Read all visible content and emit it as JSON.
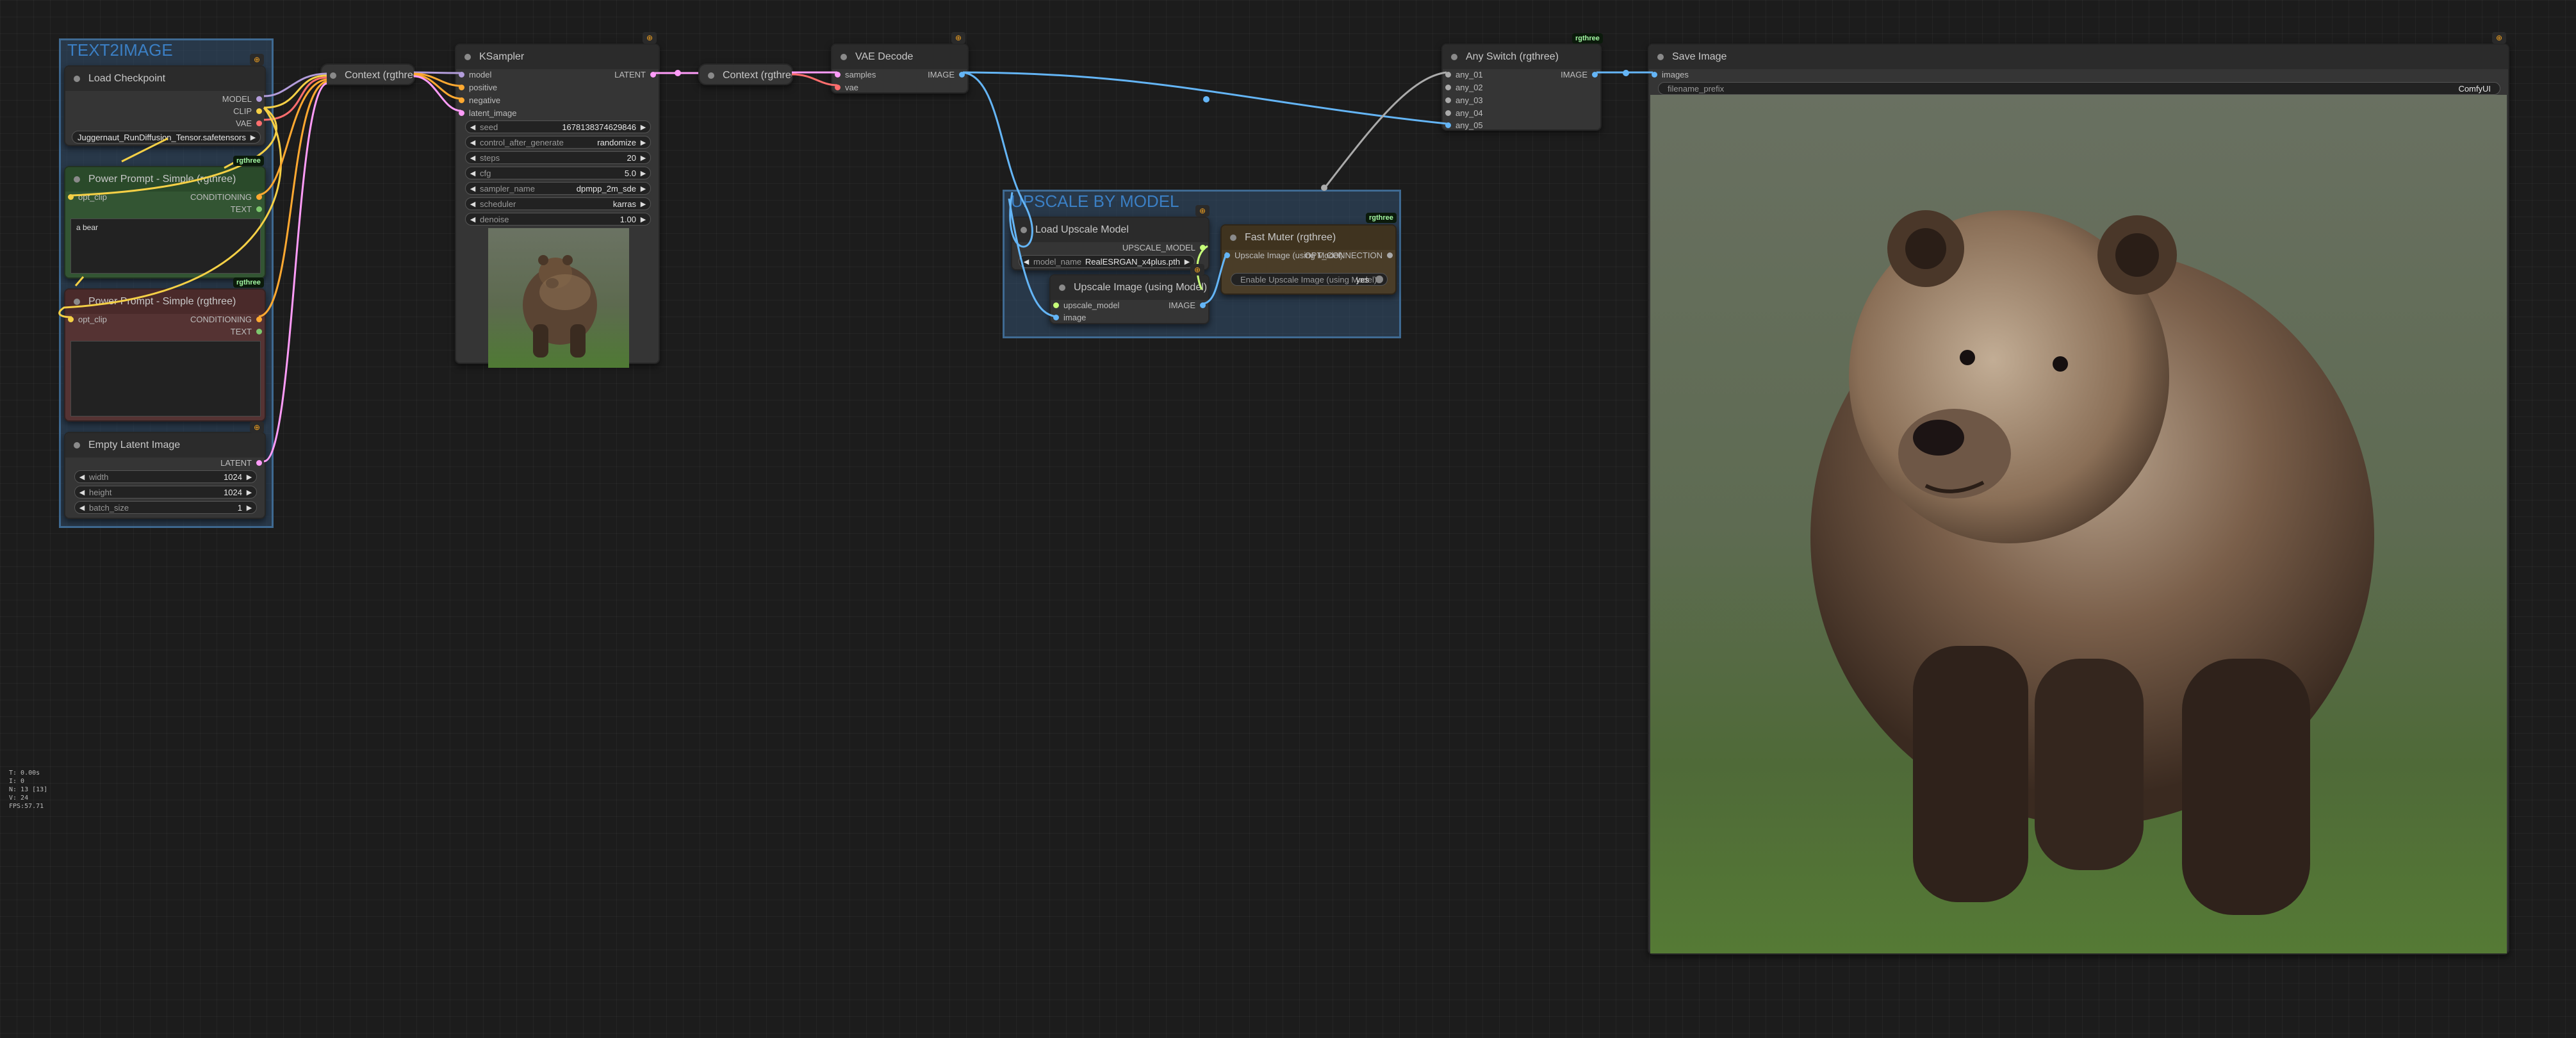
{
  "colors": {
    "model": "#b39ddb",
    "clip": "#f5d046",
    "vae": "#ff6e6e",
    "latent": "#ff9cf9",
    "conditioning": "#ffa931",
    "image": "#64b5f6",
    "upscale_model": "#c7ff79",
    "any": "#aaaaaa",
    "group": "#3f6a92",
    "badge_text": "#a3f7a3",
    "pin": "#f0a020"
  },
  "groups": {
    "text2image": "TEXT2IMAGE",
    "upscale": "UPSCALE BY MODEL"
  },
  "badge_label": "rgthree",
  "pin_icon": "pin-icon",
  "nodes": {
    "load_checkpoint": {
      "title": "Load Checkpoint",
      "outputs": [
        "MODEL",
        "CLIP",
        "VAE"
      ],
      "ckpt_name": "Juggernaut_RunDiffusion_Tensor.safetensors"
    },
    "power_prompt_pos": {
      "title": "Power Prompt - Simple (rgthree)",
      "input": "opt_clip",
      "outputs": [
        "CONDITIONING",
        "TEXT"
      ],
      "text": "a bear"
    },
    "power_prompt_neg": {
      "title": "Power Prompt - Simple (rgthree)",
      "input": "opt_clip",
      "outputs": [
        "CONDITIONING",
        "TEXT"
      ],
      "text": ""
    },
    "empty_latent": {
      "title": "Empty Latent Image",
      "output": "LATENT",
      "widgets": [
        {
          "label": "width",
          "value": "1024"
        },
        {
          "label": "height",
          "value": "1024"
        },
        {
          "label": "batch_size",
          "value": "1"
        }
      ]
    },
    "context1": {
      "title": "Context (rgthree)"
    },
    "ksampler": {
      "title": "KSampler",
      "inputs": [
        "model",
        "positive",
        "negative",
        "latent_image"
      ],
      "output": "LATENT",
      "widgets": [
        {
          "label": "seed",
          "value": "1678138374629846"
        },
        {
          "label": "control_after_generate",
          "value": "randomize"
        },
        {
          "label": "steps",
          "value": "20"
        },
        {
          "label": "cfg",
          "value": "5.0"
        },
        {
          "label": "sampler_name",
          "value": "dpmpp_2m_sde"
        },
        {
          "label": "scheduler",
          "value": "karras"
        },
        {
          "label": "denoise",
          "value": "1.00"
        }
      ]
    },
    "context2": {
      "title": "Context (rgthree)"
    },
    "vae_decode": {
      "title": "VAE Decode",
      "inputs": [
        "samples",
        "vae"
      ],
      "output": "IMAGE"
    },
    "load_upscale": {
      "title": "Load Upscale Model",
      "output": "UPSCALE_MODEL",
      "model_label": "model_name",
      "model_value": "RealESRGAN_x4plus.pth"
    },
    "upscale_image": {
      "title": "Upscale Image (using Model)",
      "inputs": [
        "upscale_model",
        "image"
      ],
      "output": "IMAGE"
    },
    "fast_muter": {
      "title": "Fast Muter (rgthree)",
      "input": "Upscale Image (using Model)",
      "output": "OPT_CONNECTION",
      "toggle_label": "Enable Upscale Image (using Model)",
      "toggle_value": "yes"
    },
    "any_switch": {
      "title": "Any Switch (rgthree)",
      "inputs": [
        "any_01",
        "any_02",
        "any_03",
        "any_04",
        "any_05"
      ],
      "output": "IMAGE"
    },
    "save_image": {
      "title": "Save Image",
      "input": "images",
      "prefix_label": "filename_prefix",
      "prefix_value": "ComfyUI"
    }
  },
  "stats": [
    "T: 0.00s",
    "I: 0",
    "N: 13 [13]",
    "V: 24",
    "FPS:57.71"
  ]
}
